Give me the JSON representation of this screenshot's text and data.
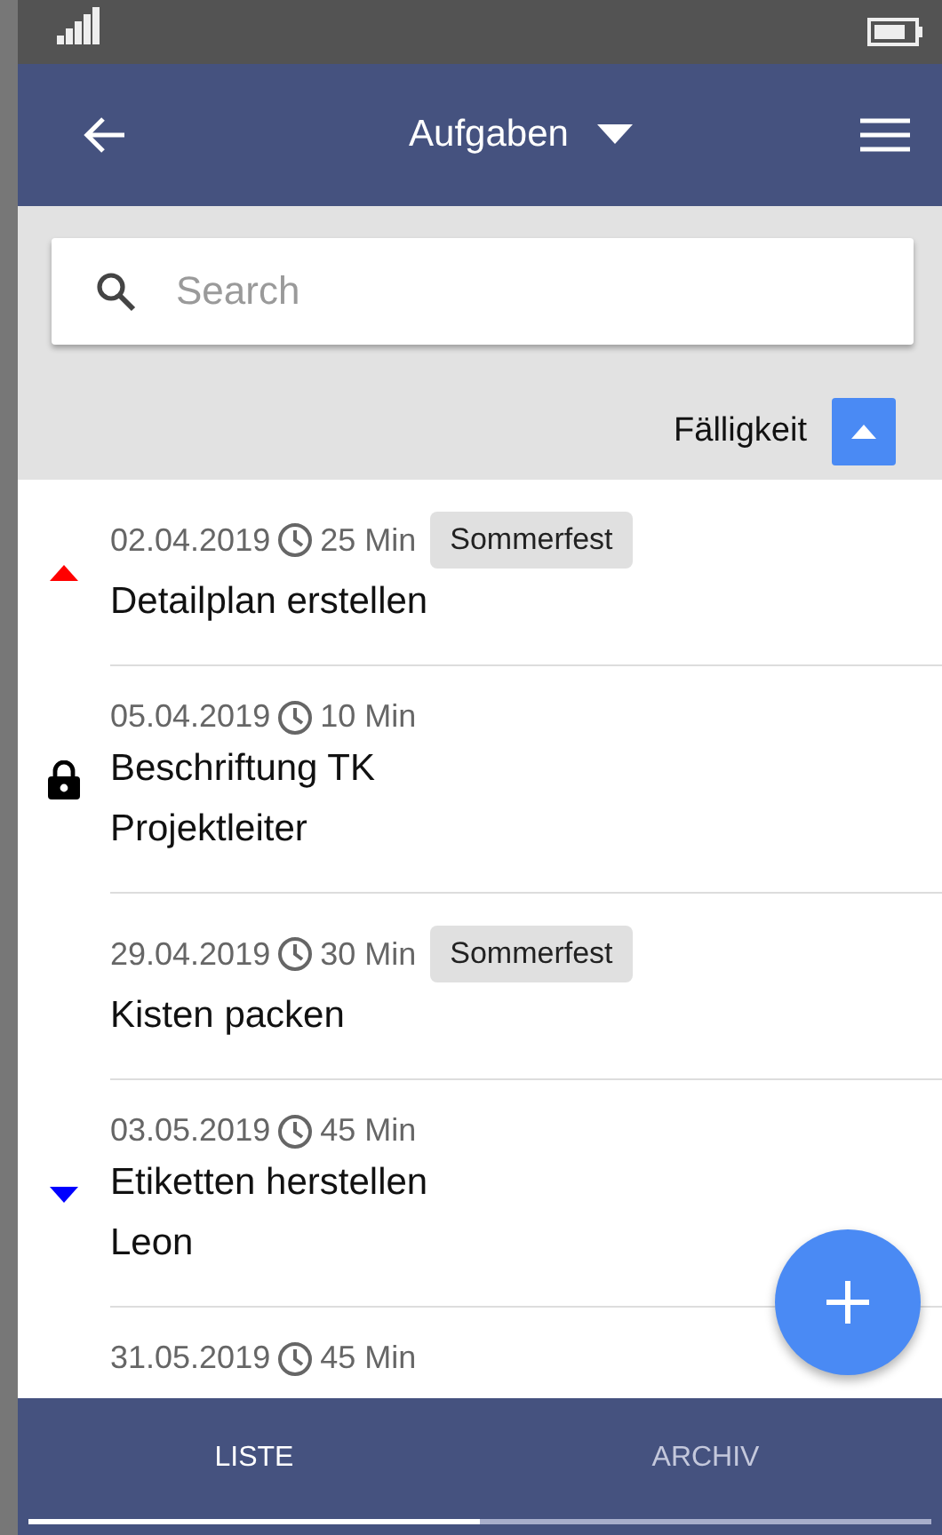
{
  "app_bar": {
    "title": "Aufgaben"
  },
  "search": {
    "placeholder": "Search"
  },
  "sort": {
    "label": "Fälligkeit",
    "ascending": true
  },
  "tasks": [
    {
      "kind": "high",
      "date": "02.04.2019",
      "duration": "25 Min",
      "tag": "Sommerfest",
      "title": "Detailplan erstellen"
    },
    {
      "kind": "locked",
      "date": "05.04.2019",
      "duration": "10 Min",
      "title": "Beschriftung TK",
      "subtitle": "Projektleiter"
    },
    {
      "kind": "plain",
      "date": "29.04.2019",
      "duration": "30 Min",
      "tag": "Sommerfest",
      "title": "Kisten packen"
    },
    {
      "kind": "low",
      "date": "03.05.2019",
      "duration": "45 Min",
      "title": "Etiketten herstellen",
      "subtitle": "Leon"
    },
    {
      "kind": "plain",
      "date": "31.05.2019",
      "duration": "45 Min"
    }
  ],
  "tabs": [
    {
      "label": "LISTE",
      "selected": true
    },
    {
      "label": "ARCHIV",
      "selected": false
    }
  ]
}
